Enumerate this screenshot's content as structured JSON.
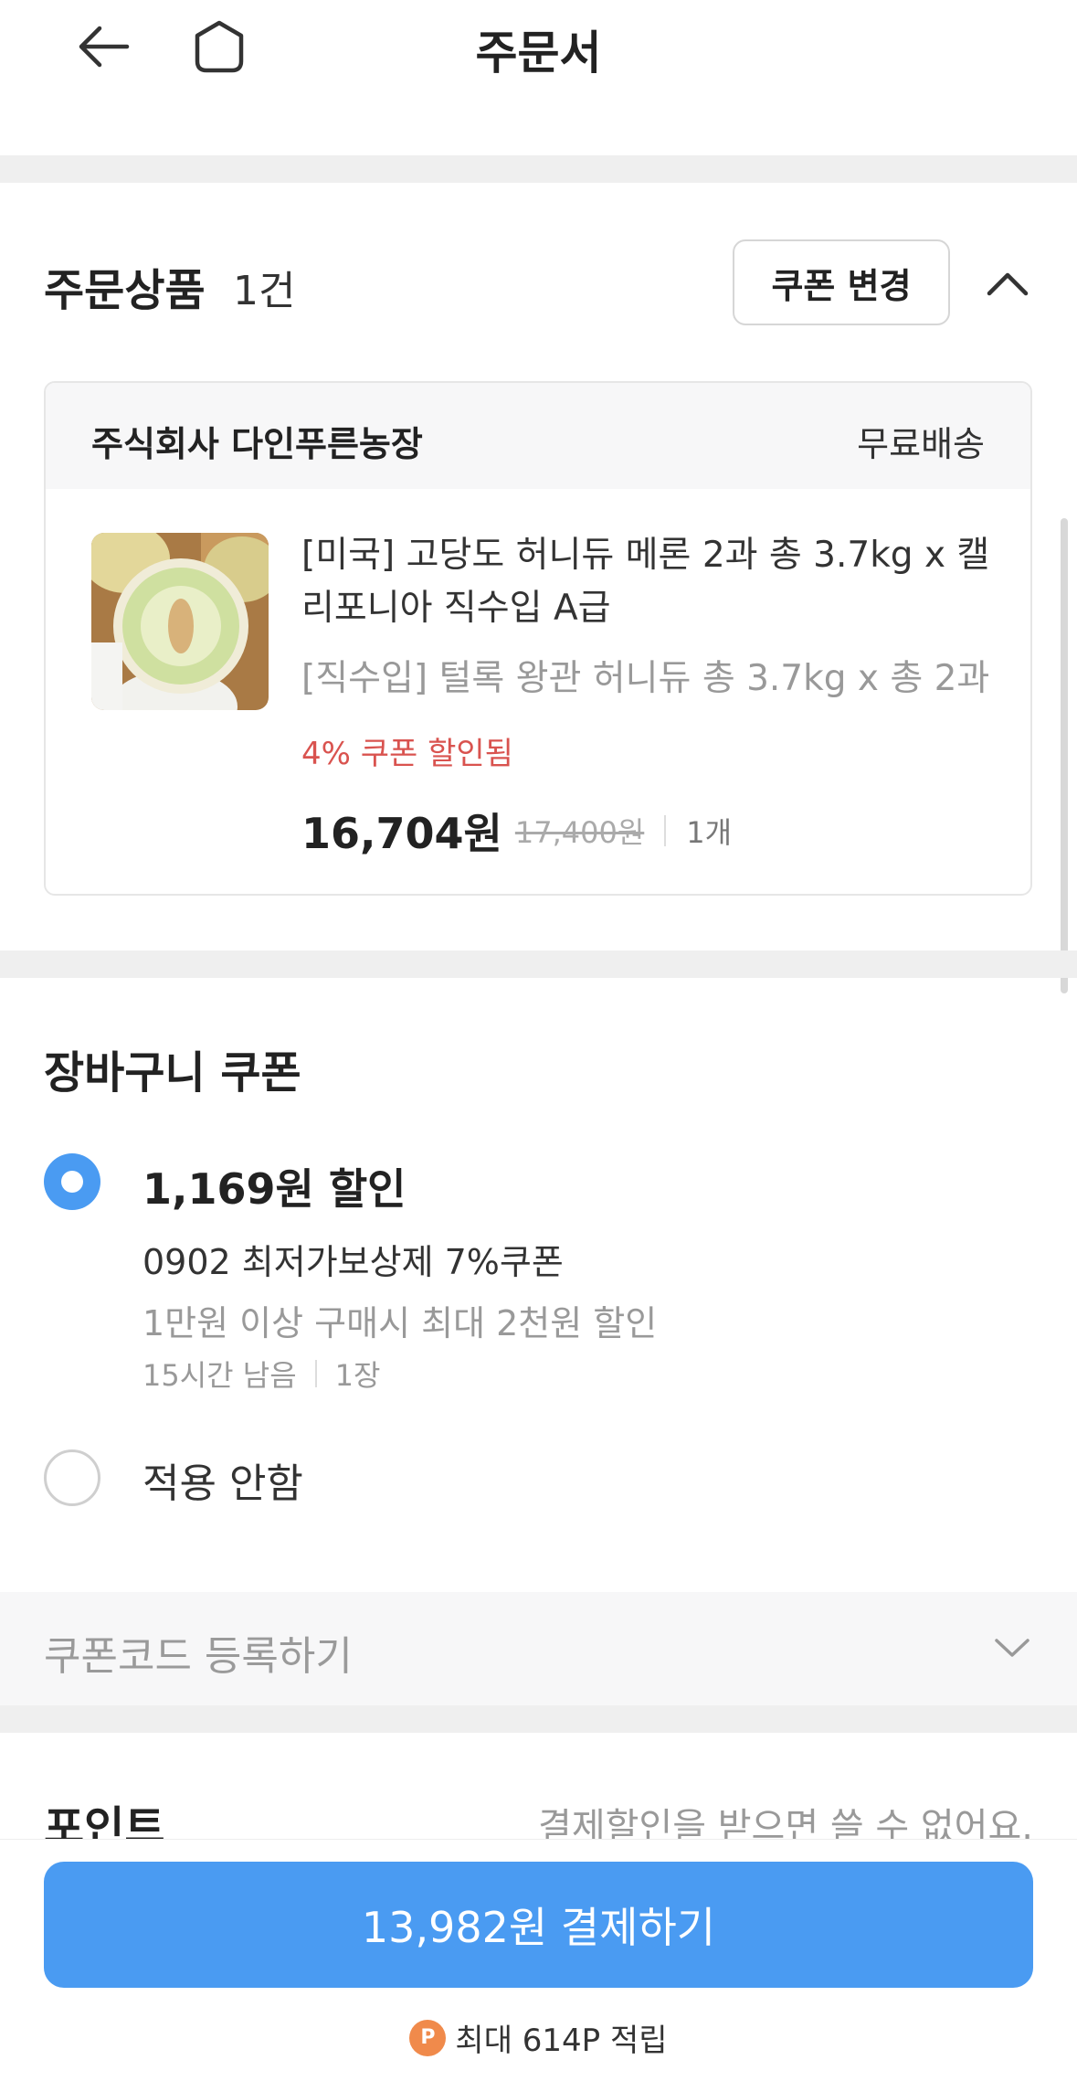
{
  "header": {
    "title": "주문서",
    "back_icon": "arrow-left-icon",
    "home_icon": "home-icon"
  },
  "order_items": {
    "title": "주문상품",
    "count": "1건",
    "coupon_change_label": "쿠폰 변경",
    "collapse_icon": "chevron-up-icon",
    "seller": {
      "name": "주식회사 다인푸른농장",
      "shipping": "무료배송"
    },
    "product": {
      "name": "[미국] 고당도 허니듀 메론 2과 총 3.7kg x 캘리포니아 직수입 A급",
      "option": "[직수입] 털록 왕관 허니듀 총 3.7kg x 총 2과",
      "coupon_note": "4% 쿠폰 할인됨",
      "price": "16,704원",
      "original_price": "17,400원",
      "quantity": "1개"
    }
  },
  "cart_coupon": {
    "title": "장바구니 쿠폰",
    "options": [
      {
        "discount": "1,169원 할인",
        "name": "0902 최저가보상제 7%쿠폰",
        "condition": "1만원 이상 구매시 최대 2천원 할인",
        "time_left": "15시간 남음",
        "count": "1장",
        "selected": true
      },
      {
        "label": "적용 안함",
        "selected": false
      }
    ],
    "code_label": "쿠폰코드 등록하기",
    "code_icon": "chevron-down-icon"
  },
  "points": {
    "title": "포인트",
    "note": "결제할인을 받으면 쓸 수 없어요."
  },
  "footer": {
    "pay_label": "13,982원 결제하기",
    "badge": "P",
    "reward": "최대 614P 적립"
  },
  "colors": {
    "accent": "#4a9bf2",
    "discount_red": "#d9534f",
    "point_orange": "#f08a4b",
    "divider": "#efefef"
  }
}
